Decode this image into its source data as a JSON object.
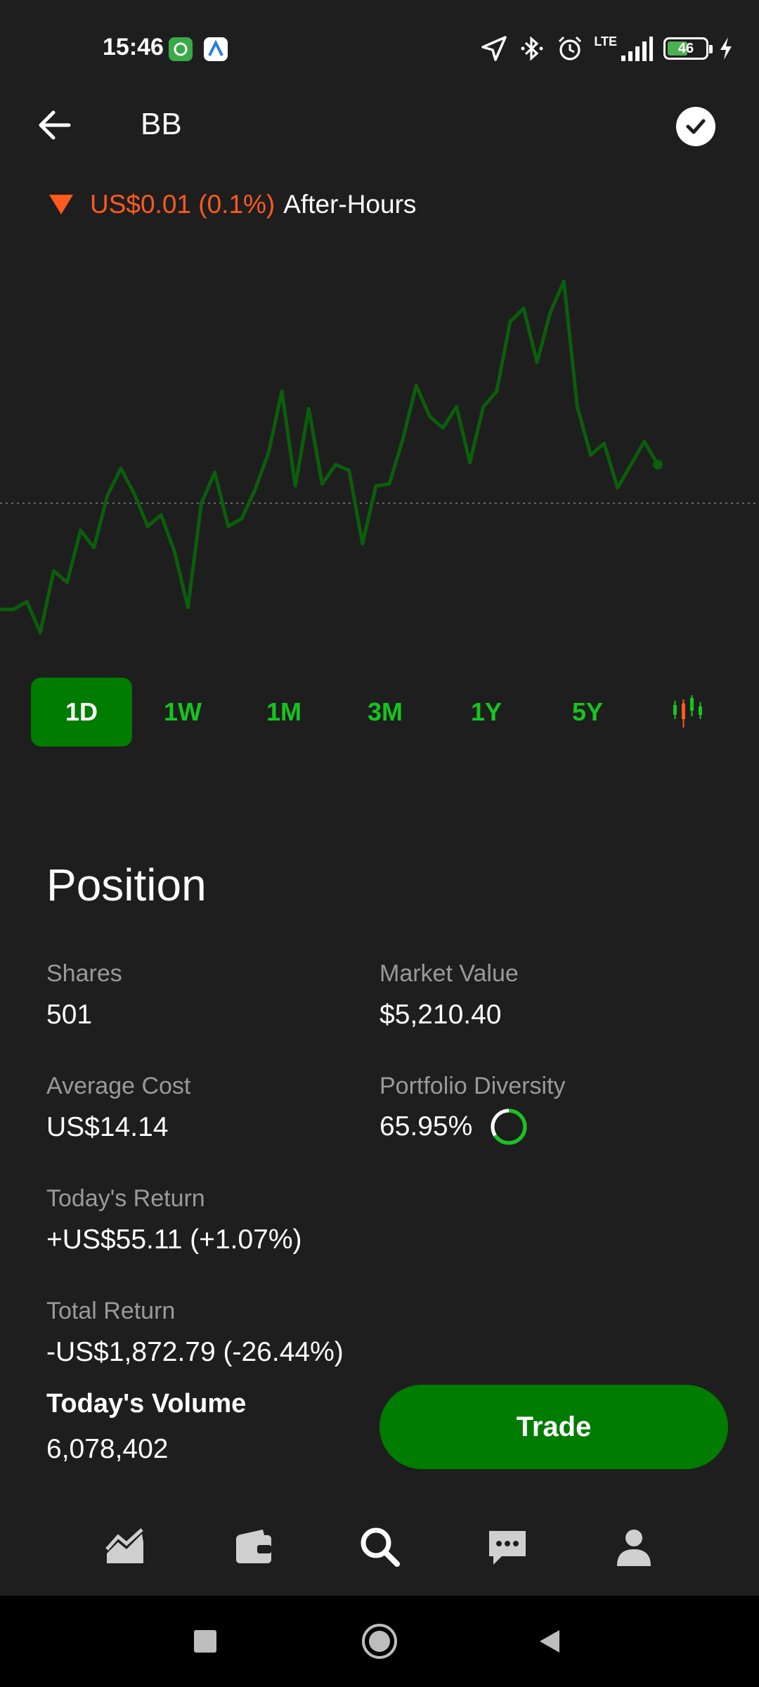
{
  "status_bar": {
    "time": "15:46",
    "network": "LTE",
    "battery": "46"
  },
  "header": {
    "title": "BB",
    "back_icon": "arrow-left-icon",
    "check_icon": "check-circle-icon"
  },
  "after_hours": {
    "change": "US$0.01 (0.1%)",
    "label": "After-Hours",
    "direction_color": "#ff5a1f"
  },
  "chart_data": {
    "type": "line",
    "line_color": "#0b5e0b",
    "baseline_style": "dotted",
    "values": [
      0.0,
      0.0,
      0.4,
      -1.2,
      2.0,
      1.4,
      4.1,
      3.2,
      5.9,
      7.3,
      6.0,
      4.3,
      4.9,
      3.0,
      0.1,
      5.5,
      7.1,
      4.3,
      4.7,
      6.2,
      8.1,
      11.3,
      6.4,
      10.4,
      6.5,
      7.5,
      7.2,
      3.4,
      6.4,
      6.5,
      8.8,
      11.6,
      10.0,
      9.4,
      10.5,
      7.6,
      10.5,
      11.3,
      14.9,
      15.6,
      12.8,
      15.4,
      17.0,
      10.5,
      8.0,
      8.6,
      6.3,
      7.5,
      8.7,
      7.5
    ],
    "baseline_index": 15
  },
  "range_tabs": [
    {
      "label": "1D",
      "active": true
    },
    {
      "label": "1W",
      "active": false
    },
    {
      "label": "1M",
      "active": false
    },
    {
      "label": "3M",
      "active": false
    },
    {
      "label": "1Y",
      "active": false
    },
    {
      "label": "5Y",
      "active": false
    }
  ],
  "position": {
    "title": "Position",
    "shares_label": "Shares",
    "shares_value": "501",
    "market_value_label": "Market Value",
    "market_value": "$5,210.40",
    "avg_cost_label": "Average Cost",
    "avg_cost": "US$14.14",
    "diversity_label": "Portfolio Diversity",
    "diversity_value": "65.95%",
    "diversity_fraction": 0.6595,
    "todays_return_label": "Today's Return",
    "todays_return": "+US$55.11 (+1.07%)",
    "total_return_label": "Total Return",
    "total_return": "-US$1,872.79 (-26.44%)",
    "volume_label": "Today's Volume",
    "volume": "6,078,402"
  },
  "trade_button": {
    "label": "Trade"
  },
  "colors": {
    "accent": "#007c00",
    "accent_text": "#15c51e",
    "background": "#1e1e1e"
  },
  "bottom_nav": [
    {
      "icon": "chart-icon",
      "name": "nav-chart"
    },
    {
      "icon": "wallet-icon",
      "name": "nav-wallet"
    },
    {
      "icon": "search-icon",
      "name": "nav-search"
    },
    {
      "icon": "chat-icon",
      "name": "nav-chat"
    },
    {
      "icon": "profile-icon",
      "name": "nav-profile"
    }
  ]
}
